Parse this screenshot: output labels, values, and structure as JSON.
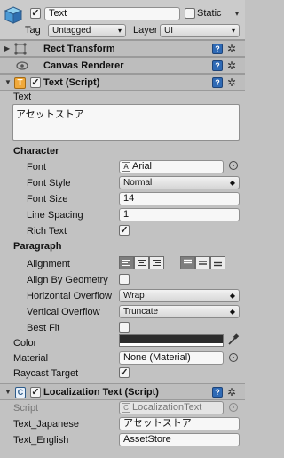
{
  "gameobject": {
    "name": "Text",
    "static_label": "Static",
    "tag_label": "Tag",
    "tag_value": "Untagged",
    "layer_label": "Layer",
    "layer_value": "UI"
  },
  "components": {
    "rect_transform": "Rect Transform",
    "canvas_renderer": "Canvas Renderer",
    "text_script": "Text (Script)",
    "localization": "Localization Text (Script)"
  },
  "text": {
    "text_label": "Text",
    "text_value": "アセットストア",
    "character_header": "Character",
    "font_label": "Font",
    "font_value": "Arial",
    "font_style_label": "Font Style",
    "font_style_value": "Normal",
    "font_size_label": "Font Size",
    "font_size_value": "14",
    "line_spacing_label": "Line Spacing",
    "line_spacing_value": "1",
    "rich_text_label": "Rich Text",
    "paragraph_header": "Paragraph",
    "alignment_label": "Alignment",
    "align_by_geometry_label": "Align By Geometry",
    "horizontal_overflow_label": "Horizontal Overflow",
    "horizontal_overflow_value": "Wrap",
    "vertical_overflow_label": "Vertical Overflow",
    "vertical_overflow_value": "Truncate",
    "best_fit_label": "Best Fit",
    "color_label": "Color",
    "color_value": "#2b2b2b",
    "material_label": "Material",
    "material_value": "None (Material)",
    "raycast_label": "Raycast Target"
  },
  "localization": {
    "script_label": "Script",
    "script_value": "LocalizationText",
    "japanese_label": "Text_Japanese",
    "japanese_value": "アセットストア",
    "english_label": "Text_English",
    "english_value": "AssetStore"
  },
  "icons": {
    "help": "?",
    "gear": "✲",
    "check": "✓",
    "dropdown_arrow": "▾",
    "fold_open": "▼",
    "fold_closed": "▶"
  }
}
